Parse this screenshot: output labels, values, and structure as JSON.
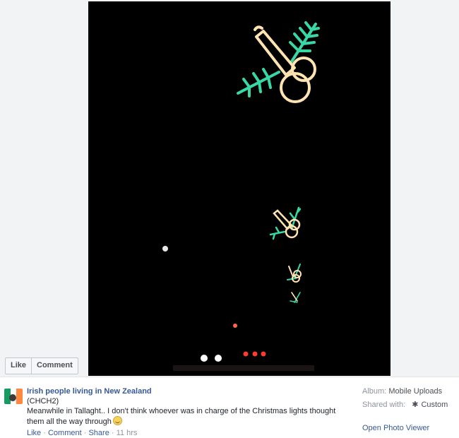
{
  "photo": {
    "alt_subject": "Christmas lights photo",
    "colors": {
      "warm": "#ffe3b0",
      "green": "#38d7a6",
      "red_light": "#ff3b2b",
      "white_light": "#ffffff"
    }
  },
  "actions": {
    "like_label": "Like",
    "comment_label": "Comment"
  },
  "post": {
    "page_name": "Irish people living in New Zealand",
    "subtag": "(CHCH2)",
    "message": "Meanwhile in Tallaght.. I don't think whoever was in charge of the Christmas lights thought them all the way through",
    "emoji_icon": "laughing-emoji-icon",
    "meta": {
      "like": "Like",
      "comment": "Comment",
      "share": "Share",
      "time": "11 hrs",
      "separator": "·"
    }
  },
  "side": {
    "album_label": "Album:",
    "album_value": "Mobile Uploads",
    "shared_label": "Shared with:",
    "shared_icon": "gear-icon",
    "shared_value": "Custom",
    "open_viewer": "Open Photo Viewer"
  }
}
